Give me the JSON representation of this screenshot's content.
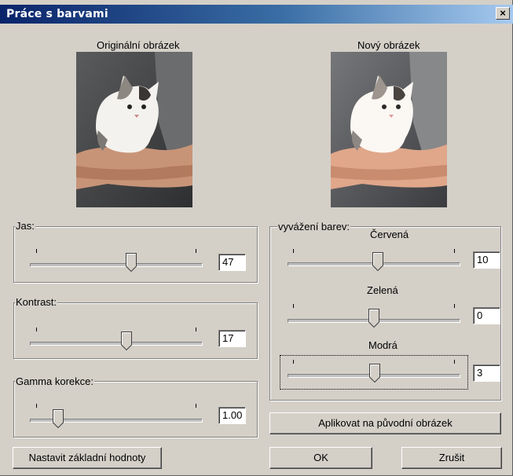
{
  "window": {
    "title": "Práce s barvami",
    "close_glyph": "×"
  },
  "images": {
    "original_label": "Originální obrázek",
    "new_label": "Nový obrázek",
    "original_icon": "kitten-photo",
    "new_icon": "kitten-photo-adjusted"
  },
  "brightness": {
    "label": "Jas:",
    "value": "47",
    "level": 0.62
  },
  "contrast": {
    "label": "Kontrast:",
    "value": "17",
    "level": 0.58
  },
  "gamma": {
    "label": "Gamma korekce:",
    "value": "1.00",
    "level": 0.16
  },
  "color_balance": {
    "label": "vyvážení barev:",
    "red": {
      "label": "Červená",
      "value": "10",
      "level": 0.54
    },
    "green": {
      "label": "Zelená",
      "value": "0",
      "level": 0.5
    },
    "blue": {
      "label": "Modrá",
      "value": "3",
      "level": 0.51
    }
  },
  "buttons": {
    "apply": "Aplikovat na původní obrázek",
    "reset": "Nastavit základní hodnoty",
    "ok": "OK",
    "cancel": "Zrušit"
  },
  "colors": {
    "titlebar_start": "#0a246a",
    "titlebar_end": "#a6caf0",
    "face": "#d4d0c8"
  }
}
